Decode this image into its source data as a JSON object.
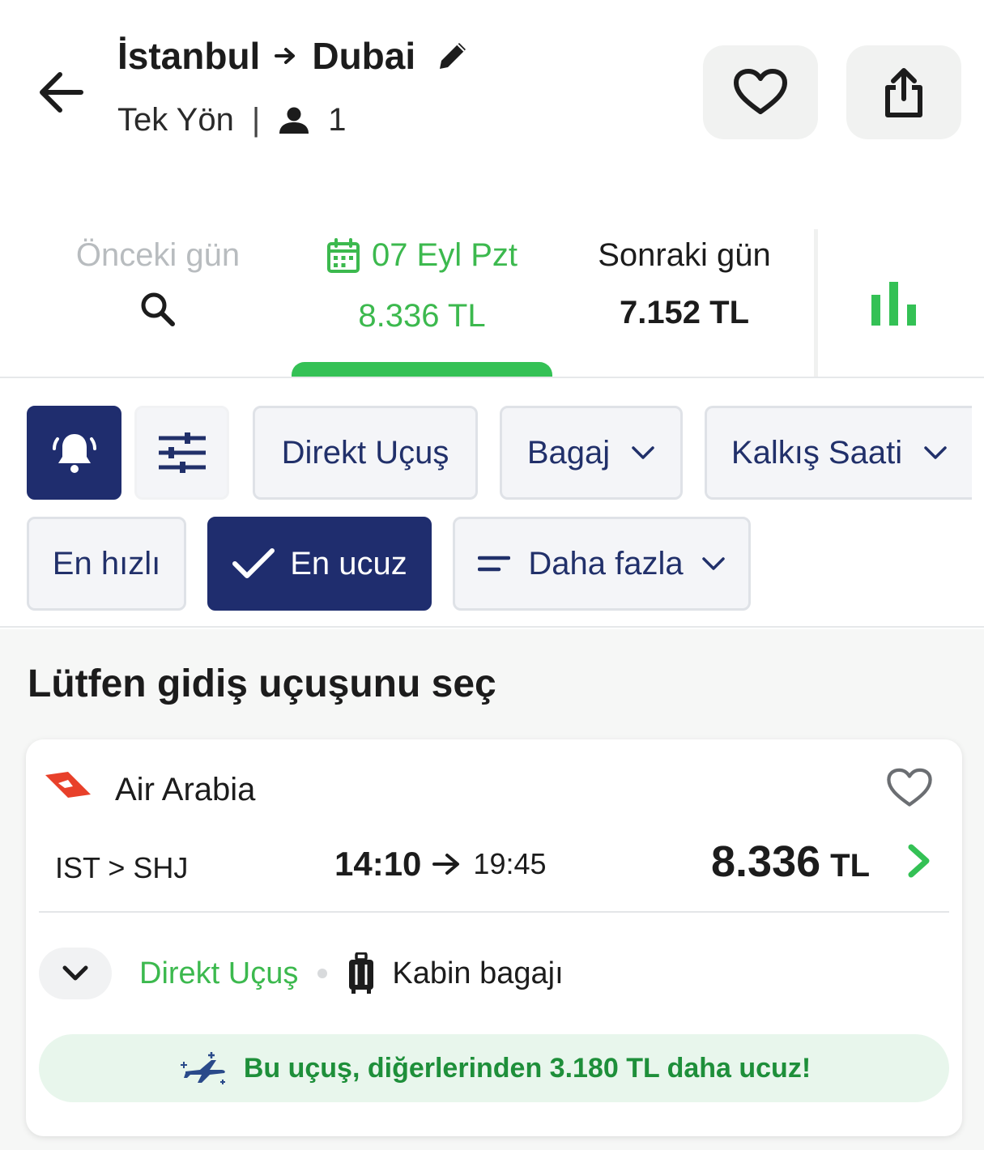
{
  "header": {
    "origin": "İstanbul",
    "destination": "Dubai",
    "trip_type": "Tek Yön",
    "separator": "|",
    "passengers": "1",
    "icons": {
      "back": "arrow-left-icon",
      "edit": "pencil-icon",
      "favorite": "heart-icon",
      "share": "share-icon",
      "passenger": "person-icon"
    }
  },
  "date_tabs": {
    "previous": {
      "label": "Önceki gün",
      "icon": "search-icon"
    },
    "current": {
      "label": "07 Eyl Pzt",
      "price": "8.336 TL",
      "icon": "calendar-icon"
    },
    "next": {
      "label": "Sonraki gün",
      "price": "7.152 TL"
    },
    "chart_icon": "bar-chart-icon"
  },
  "filters": {
    "alert_icon": "bell-icon",
    "settings_icon": "sliders-icon",
    "direct": "Direkt Uçuş",
    "baggage": "Bagaj",
    "departure_time": "Kalkış Saati",
    "fastest": "En hızlı",
    "cheapest": "En ucuz",
    "more": "Daha fazla"
  },
  "results": {
    "title": "Lütfen gidiş uçuşunu seç",
    "flights": [
      {
        "airline": "Air Arabia",
        "route": "IST > SHJ",
        "departure": "14:10",
        "arrival": "19:45",
        "price": "8.336",
        "currency": "TL",
        "stops_label": "Direkt Uçuş",
        "baggage_label": "Kabin bagajı",
        "promo": "Bu uçuş, diğerlerinden 3.180 TL daha ucuz!"
      }
    ]
  },
  "colors": {
    "accent_green": "#34c155",
    "navy": "#1f2d6e",
    "logo_red": "#e8402a"
  }
}
